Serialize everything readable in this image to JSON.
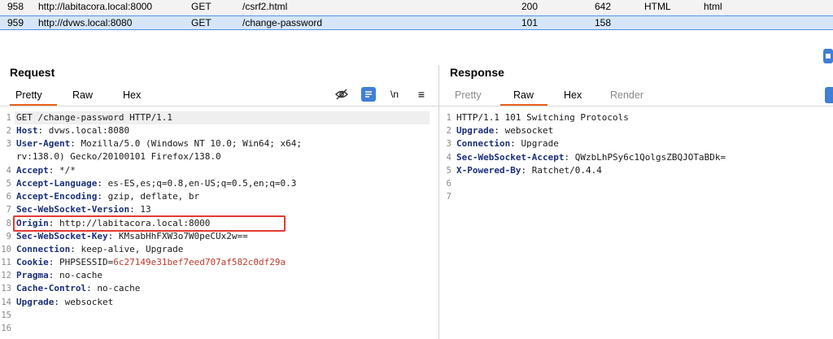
{
  "history": [
    {
      "num": "958",
      "host": "http://labitacora.local:8000",
      "method": "GET",
      "url": "/csrf2.html",
      "status": "200",
      "length": "642",
      "mime": "HTML",
      "ext": "html"
    },
    {
      "num": "959",
      "host": "http://dvws.local:8080",
      "method": "GET",
      "url": "/change-password",
      "status": "101",
      "length": "158",
      "mime": "",
      "ext": ""
    }
  ],
  "request": {
    "title": "Request",
    "tabs": [
      "Pretty",
      "Raw",
      "Hex"
    ],
    "tools": {
      "newline": "\\n",
      "menu": "≡"
    },
    "lines": [
      {
        "n": "1",
        "text": "GET /change-password HTTP/1.1"
      },
      {
        "n": "2",
        "name": "Host",
        "value": "dvws.local:8080"
      },
      {
        "n": "3",
        "name": "User-Agent",
        "value": "Mozilla/5.0 (Windows NT 10.0; Win64; x64;",
        "cont": "rv:138.0) Gecko/20100101 Firefox/138.0"
      },
      {
        "n": "4",
        "name": "Accept",
        "value": "*/*"
      },
      {
        "n": "5",
        "name": "Accept-Language",
        "value": "es-ES,es;q=0.8,en-US;q=0.5,en;q=0.3"
      },
      {
        "n": "6",
        "name": "Accept-Encoding",
        "value": "gzip, deflate, br"
      },
      {
        "n": "7",
        "name": "Sec-WebSocket-Version",
        "value": "13"
      },
      {
        "n": "8",
        "name": "Origin",
        "value": "http://labitacora.local:8000"
      },
      {
        "n": "9",
        "name": "Sec-WebSocket-Key",
        "value": "KMsabHhFXW3o7W0peCUx2w=="
      },
      {
        "n": "10",
        "name": "Connection",
        "value": "keep-alive, Upgrade"
      },
      {
        "n": "11",
        "name": "Cookie",
        "cookie_name": "PHPSESSID",
        "cookie_value": "6c27149e31bef7eed707af582c0df29a"
      },
      {
        "n": "12",
        "name": "Pragma",
        "value": "no-cache"
      },
      {
        "n": "13",
        "name": "Cache-Control",
        "value": "no-cache"
      },
      {
        "n": "14",
        "name": "Upgrade",
        "value": "websocket"
      },
      {
        "n": "15"
      },
      {
        "n": "16"
      }
    ]
  },
  "response": {
    "title": "Response",
    "tabs": [
      "Pretty",
      "Raw",
      "Hex",
      "Render"
    ],
    "lines": [
      {
        "n": "1",
        "text": "HTTP/1.1 101 Switching Protocols"
      },
      {
        "n": "2",
        "name": "Upgrade",
        "value": "websocket"
      },
      {
        "n": "3",
        "name": "Connection",
        "value": "Upgrade"
      },
      {
        "n": "4",
        "name": "Sec-WebSocket-Accept",
        "value": "QWzbLhPSy6c1QolgsZBQJOTaBDk="
      },
      {
        "n": "5",
        "name": "X-Powered-By",
        "value": "Ratchet/0.4.4"
      },
      {
        "n": "6"
      },
      {
        "n": "7"
      }
    ]
  },
  "colors": {
    "accent_tab": "#e8611a",
    "header_name": "#1b2f7a",
    "cookie_value": "#c0392b",
    "highlight_box": "#e53935",
    "selected_row": "#d6e6f8"
  }
}
